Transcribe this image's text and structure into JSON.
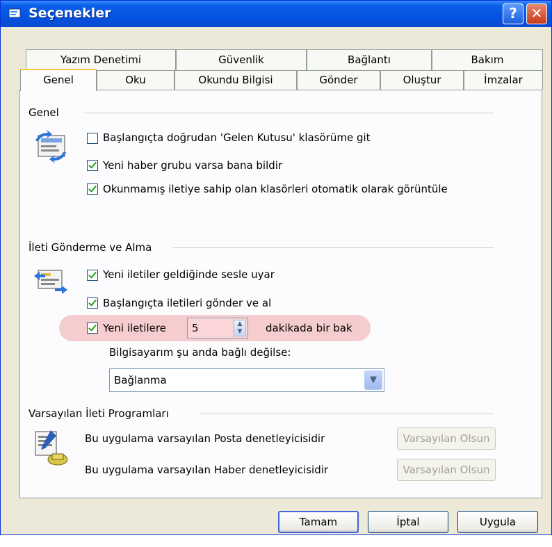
{
  "window": {
    "title": "Seçenekler"
  },
  "tabs_row1": [
    "Yazım Denetimi",
    "Güvenlik",
    "Bağlantı",
    "Bakım"
  ],
  "tabs_row2": [
    "Genel",
    "Oku",
    "Okundu Bilgisi",
    "Gönder",
    "Oluştur",
    "İmzalar"
  ],
  "active_tab": "Genel",
  "genel": {
    "title": "Genel",
    "opt1": {
      "label": "Başlangıçta doğrudan 'Gelen Kutusu' klasörüme git",
      "checked": false
    },
    "opt2": {
      "label": "Yeni haber grubu varsa bana bildir",
      "checked": true
    },
    "opt3": {
      "label": "Okunmamış iletiye sahip olan klasörleri otomatik olarak görüntüle",
      "checked": true
    }
  },
  "ileti": {
    "title": "İleti Gönderme ve Alma",
    "opt1": {
      "label": "Yeni iletiler geldiğinde sesle uyar",
      "checked": true
    },
    "opt2": {
      "label": "Başlangıçta iletileri gönder ve al",
      "checked": true
    },
    "opt3": {
      "label_before": "Yeni iletilere",
      "value": "5",
      "label_after": "dakikada bir bak",
      "checked": true
    },
    "offline_label": "Bilgisayarım şu anda bağlı değilse:",
    "offline_value": "Bağlanma"
  },
  "varsayilan": {
    "title": "Varsayılan İleti Programları",
    "mail_text": "Bu uygulama varsayılan Posta denetleyicisidir",
    "news_text": "Bu uygulama varsayılan Haber denetleyicisidir",
    "mail_button": "Varsayılan Olsun",
    "news_button": "Varsayılan Olsun"
  },
  "buttons": {
    "ok": "Tamam",
    "cancel": "İptal",
    "apply": "Uygula"
  },
  "colors": {
    "titlebar": "#0553e1",
    "highlight": "#f4c4c6",
    "dialog_bg": "#ece9d8"
  },
  "icons": [
    "window-icon",
    "help-icon",
    "close-icon",
    "mail-sync-icon",
    "send-receive-icon",
    "default-program-icon",
    "spinner-icon",
    "dropdown-arrow-icon"
  ]
}
